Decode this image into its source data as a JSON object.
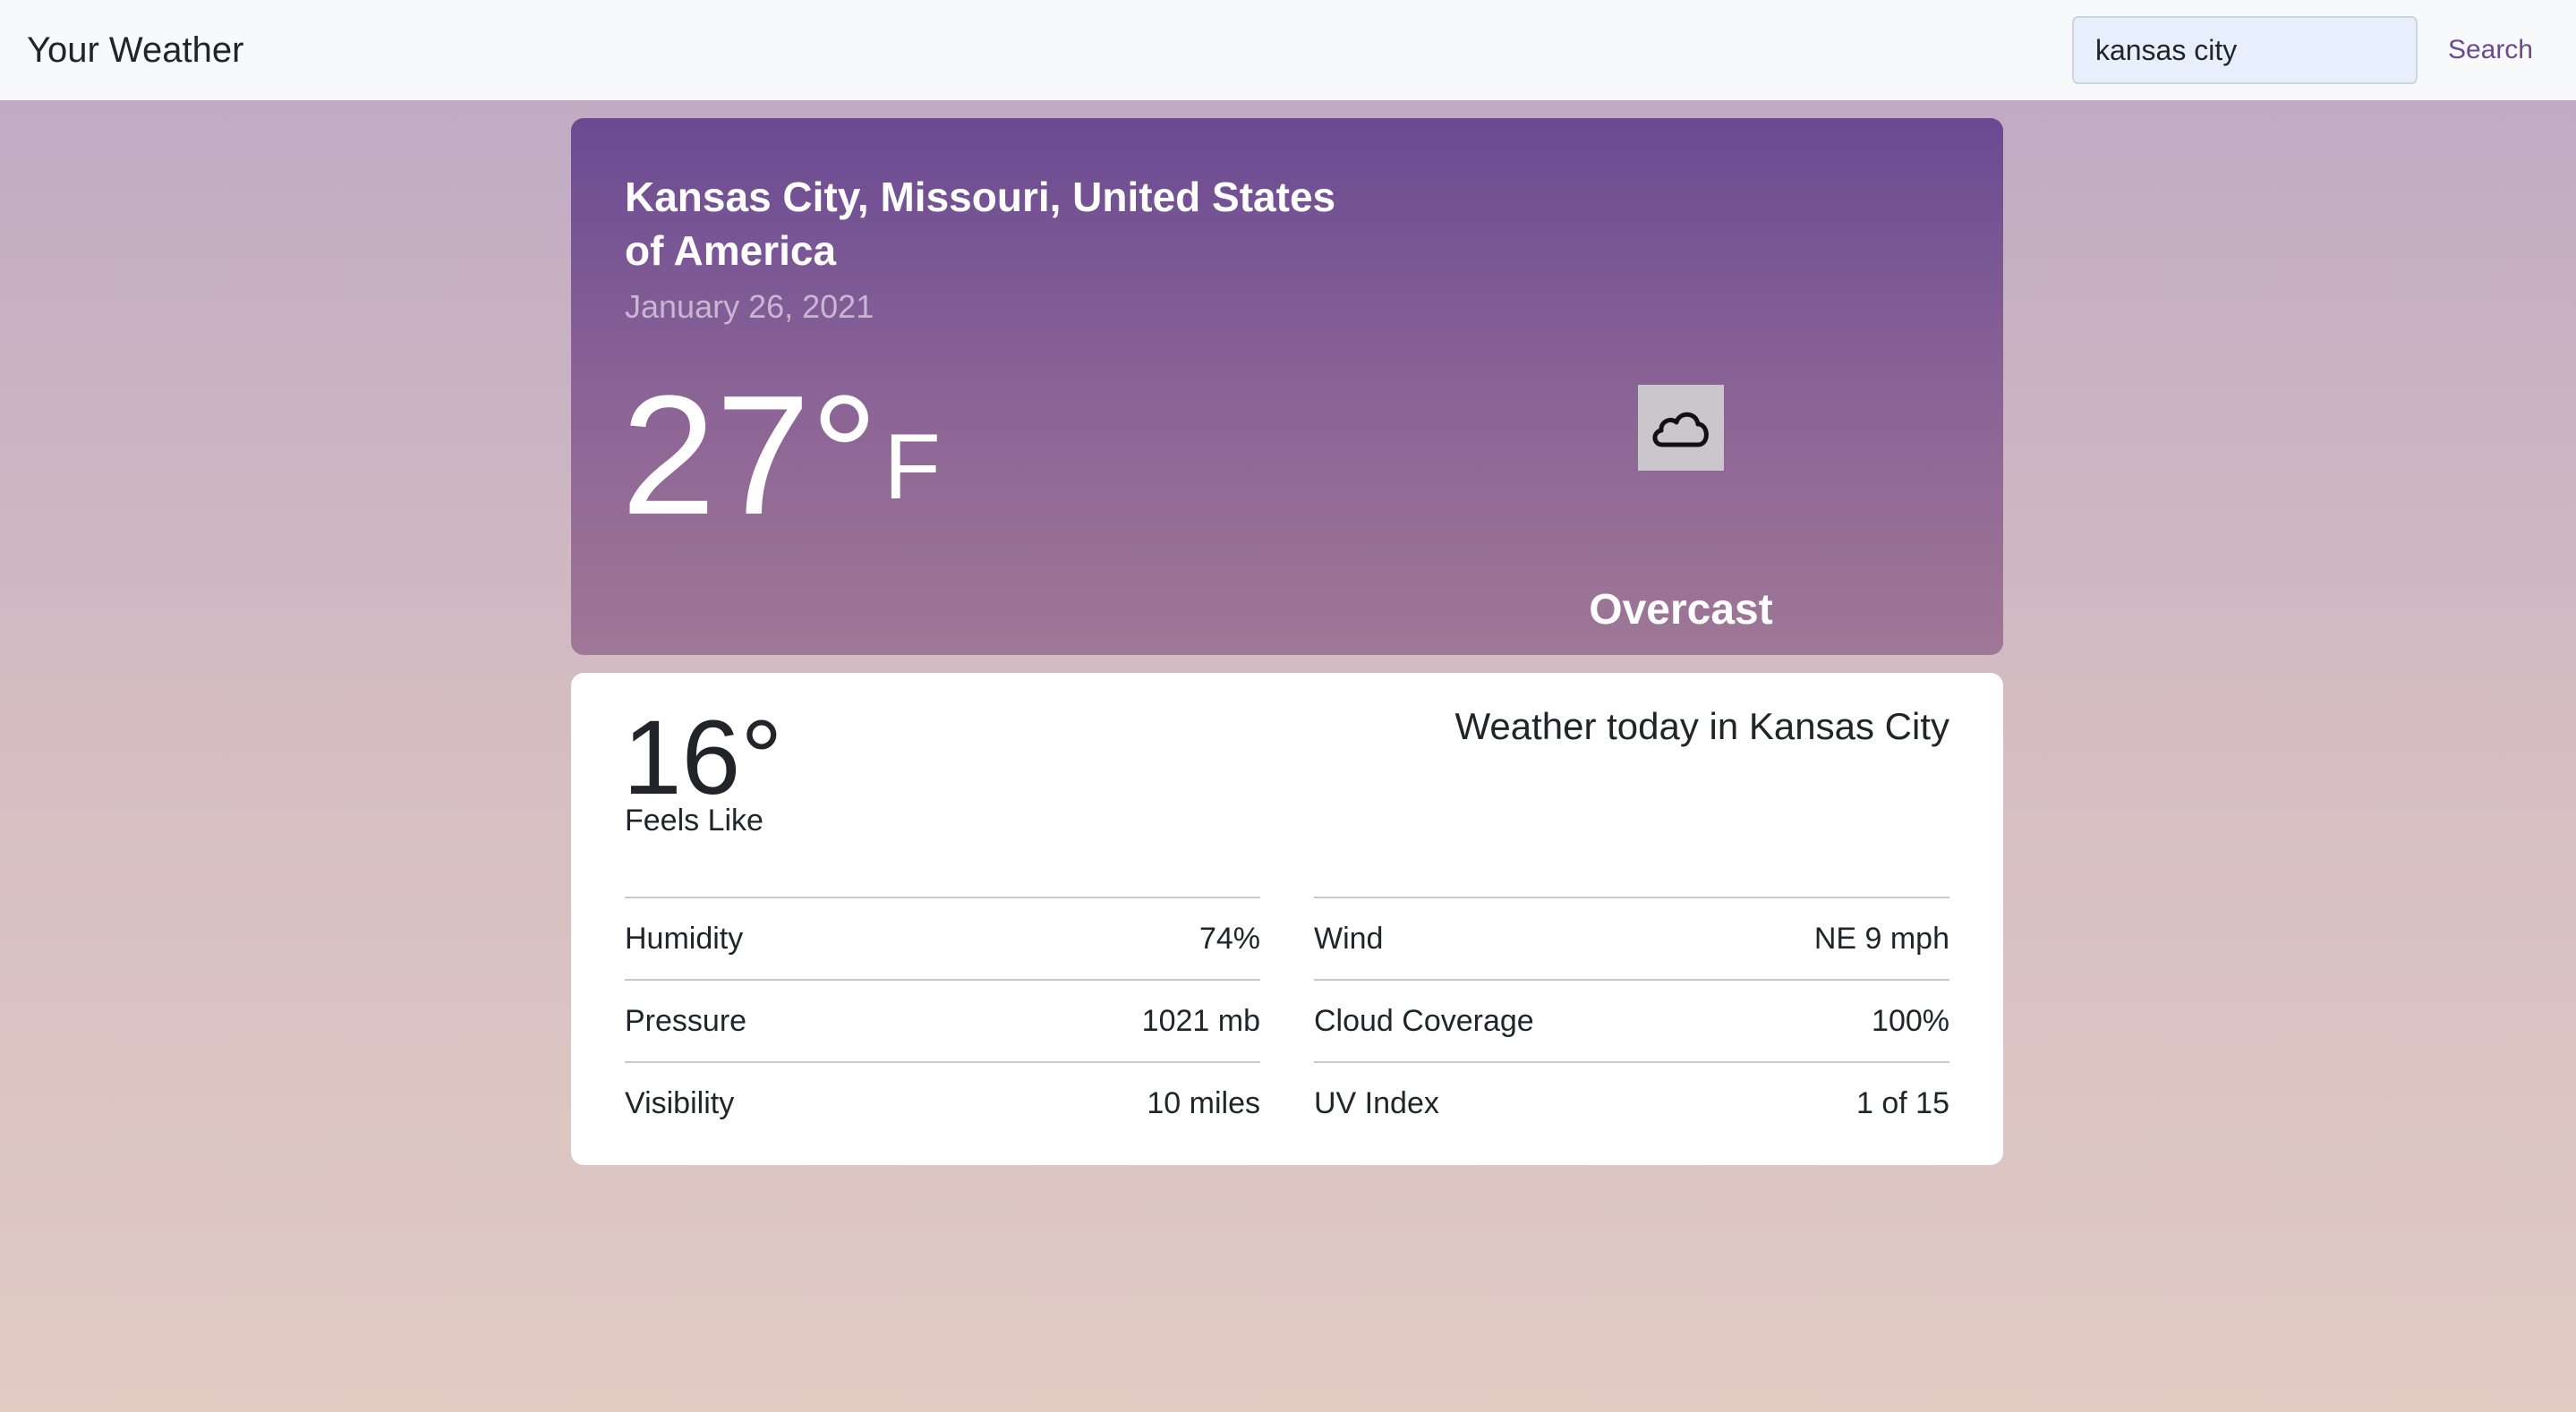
{
  "navbar": {
    "brand": "Your Weather",
    "search_value": "kansas city",
    "search_label": "Search"
  },
  "current": {
    "location": "Kansas City, Missouri, United States of America",
    "date": "January 26, 2021",
    "temperature": "27°",
    "unit": "F",
    "condition": "Overcast",
    "condition_icon": "cloud-icon"
  },
  "details": {
    "feels_like_value": "16°",
    "feels_like_label": "Feels Like",
    "heading": "Weather today in Kansas City",
    "left_stats": [
      {
        "label": "Humidity",
        "value": "74%"
      },
      {
        "label": "Pressure",
        "value": "1021 mb"
      },
      {
        "label": "Visibility",
        "value": "10 miles"
      }
    ],
    "right_stats": [
      {
        "label": "Wind",
        "value": "NE 9 mph"
      },
      {
        "label": "Cloud Coverage",
        "value": "100%"
      },
      {
        "label": "UV Index",
        "value": "1 of 15"
      }
    ]
  },
  "colors": {
    "hero_top": "#6a4a92",
    "hero_bottom": "#9f7896",
    "accent_link": "#6b4a8f"
  }
}
